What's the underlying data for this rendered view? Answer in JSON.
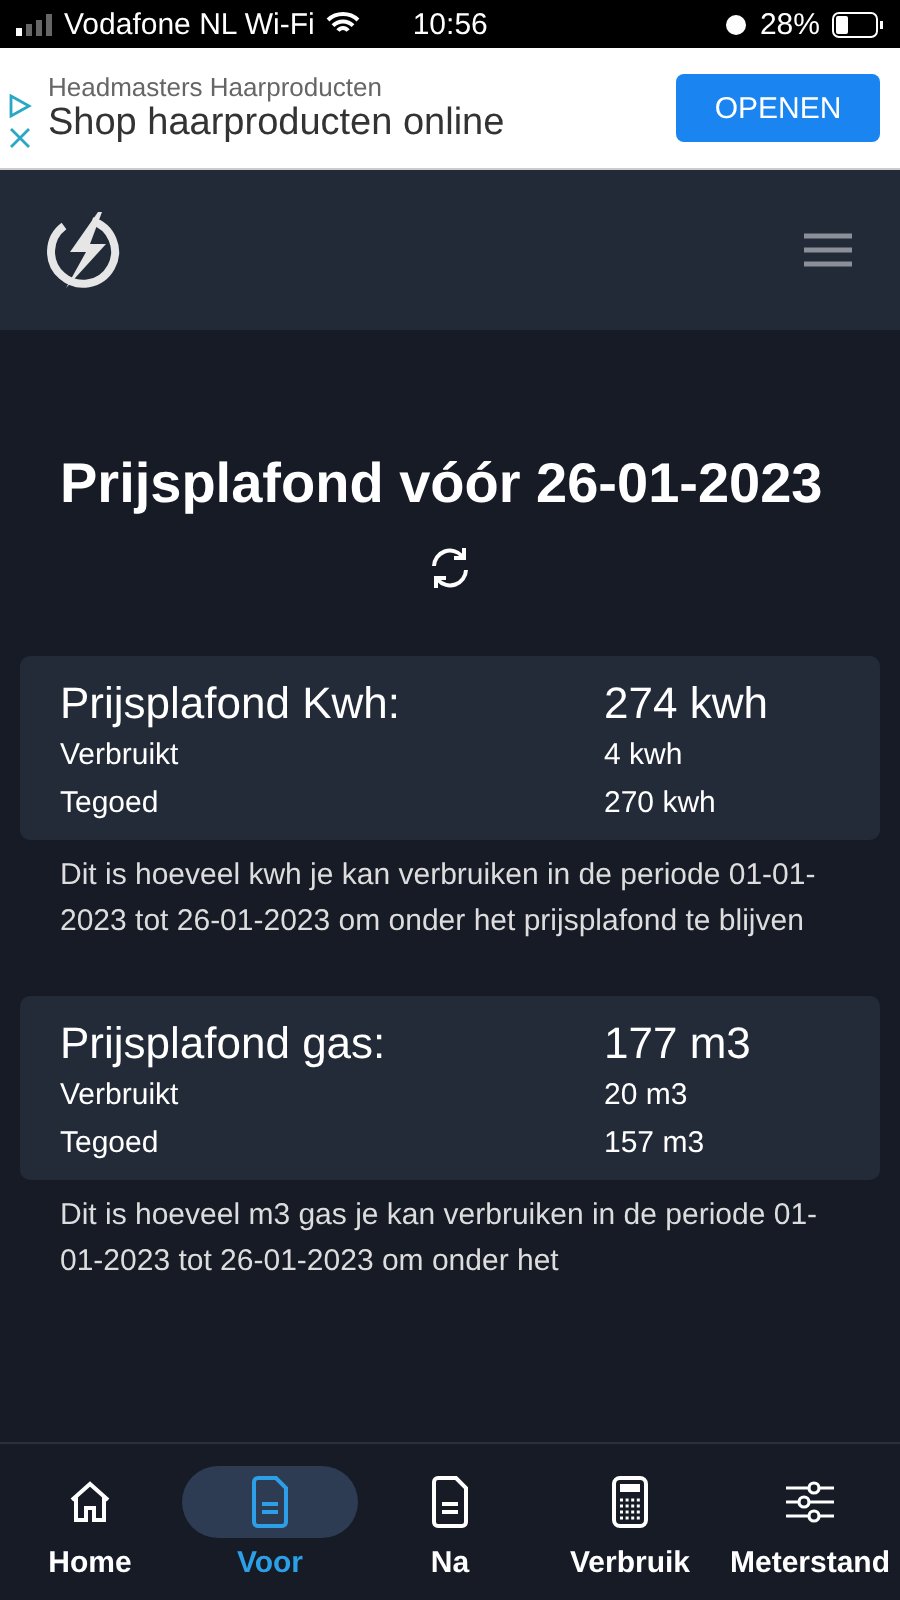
{
  "status_bar": {
    "carrier": "Vodafone NL Wi-Fi",
    "time": "10:56",
    "battery": "28%"
  },
  "ad": {
    "advertiser": "Headmasters Haarproducten",
    "headline": "Shop haarproducten online",
    "button": "OPENEN"
  },
  "page": {
    "title": "Prijsplafond vóór 26-01-2023"
  },
  "cards": [
    {
      "title": "Prijsplafond Kwh:",
      "total": "274 kwh",
      "rows": [
        {
          "label": "Verbruikt",
          "value": "4 kwh"
        },
        {
          "label": "Tegoed",
          "value": "270 kwh"
        }
      ],
      "description": "Dit is hoeveel kwh je kan verbruiken in de periode 01-01-2023 tot 26-01-2023 om onder het prijsplafond te blijven"
    },
    {
      "title": "Prijsplafond gas:",
      "total": "177 m3",
      "rows": [
        {
          "label": "Verbruikt",
          "value": "20 m3"
        },
        {
          "label": "Tegoed",
          "value": "157 m3"
        }
      ],
      "description": "Dit is hoeveel m3 gas je kan verbruiken in de periode 01-01-2023 tot 26-01-2023 om onder het"
    }
  ],
  "bottom_nav": [
    {
      "label": "Home",
      "selected": false
    },
    {
      "label": "Voor",
      "selected": true
    },
    {
      "label": "Na",
      "selected": false
    },
    {
      "label": "Verbruik",
      "selected": false
    },
    {
      "label": "Meterstand",
      "selected": false
    }
  ]
}
